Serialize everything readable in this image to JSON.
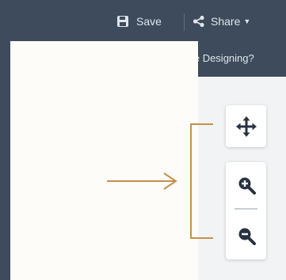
{
  "toolbar": {
    "save_label": "Save",
    "save_icon": "floppy-disk-icon",
    "share_label": "Share",
    "share_icon": "share-icon",
    "done_label": "Done Designing?"
  },
  "map_controls": {
    "pan_icon": "move-arrows-icon",
    "zoom_in_icon": "zoom-in-icon",
    "zoom_out_icon": "zoom-out-icon"
  },
  "colors": {
    "toolbar": "#3d4b5c",
    "annotation": "#c4904e",
    "icon": "#2a3340"
  }
}
